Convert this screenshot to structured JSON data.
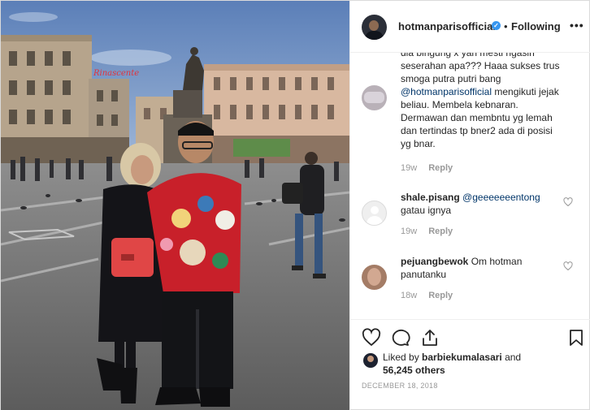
{
  "header": {
    "username": "hotmanparisofficial",
    "separator": "•",
    "follow_state": "Following",
    "more_symbol": "•••"
  },
  "photo": {
    "sign_text": "Rinascente"
  },
  "comments": [
    {
      "user": "",
      "lines_plain_before": "dia bingung x yah mesti ngasih seserahan apa??? Haaa sukses trus smoga putra putri bang ",
      "mention": "@hotmanparisofficial",
      "lines_plain_after": " mengikuti jejak beliau. Membela kebnaran. Dermawan dan membntu yg lemah dan tertindas tp bner2 ada di posisi yg bnar.",
      "age": "19w",
      "reply": "Reply"
    },
    {
      "user": "shale.pisang",
      "mention": "@geeeeeeentong",
      "text": "gatau ignya",
      "age": "19w",
      "reply": "Reply"
    },
    {
      "user": "pejuangbewok",
      "text": "Om hotman panutanku",
      "age": "18w",
      "reply": "Reply"
    }
  ],
  "likes": {
    "prefix": "Liked by ",
    "first_liker": "barbiekumalasari",
    "joiner": " and",
    "count_text": "56,245 others"
  },
  "date": "DECEMBER 18, 2018",
  "icons": [
    "heart-icon",
    "comment-icon",
    "share-icon",
    "bookmark-icon",
    "verified-badge-icon",
    "more-options-icon"
  ],
  "colors": {
    "verified_blue": "#3897f0",
    "mention_blue": "#003569",
    "meta_gray": "#999999",
    "jacket_red": "#c8202a"
  }
}
